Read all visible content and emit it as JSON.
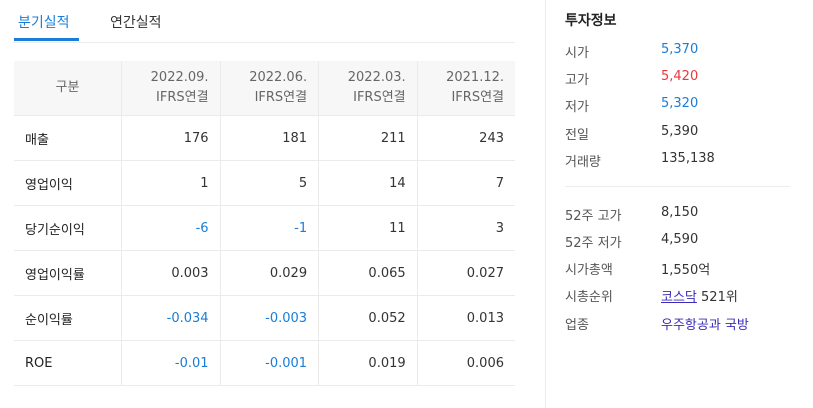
{
  "tabs": [
    {
      "label": "분기실적",
      "active": true
    },
    {
      "label": "연간실적",
      "active": false
    }
  ],
  "financials": {
    "header_label": "구분",
    "columns": [
      {
        "period": "2022.09.",
        "basis": "IFRS연결"
      },
      {
        "period": "2022.06.",
        "basis": "IFRS연결"
      },
      {
        "period": "2022.03.",
        "basis": "IFRS연결"
      },
      {
        "period": "2021.12.",
        "basis": "IFRS연결"
      }
    ],
    "rows": [
      {
        "label": "매출",
        "values": [
          "176",
          "181",
          "211",
          "243"
        ]
      },
      {
        "label": "영업이익",
        "values": [
          "1",
          "5",
          "14",
          "7"
        ]
      },
      {
        "label": "당기순이익",
        "values": [
          "-6",
          "-1",
          "11",
          "3"
        ]
      },
      {
        "label": "영업이익률",
        "values": [
          "0.003",
          "0.029",
          "0.065",
          "0.027"
        ]
      },
      {
        "label": "순이익률",
        "values": [
          "-0.034",
          "-0.003",
          "0.052",
          "0.013"
        ]
      },
      {
        "label": "ROE",
        "values": [
          "-0.01",
          "-0.001",
          "0.019",
          "0.006"
        ]
      }
    ]
  },
  "investment_info": {
    "title": "투자정보",
    "price": [
      {
        "label": "시가",
        "value": "5,370",
        "color": "#1a7dd6"
      },
      {
        "label": "고가",
        "value": "5,420",
        "color": "#e8383d"
      },
      {
        "label": "저가",
        "value": "5,320",
        "color": "#1a7dd6"
      },
      {
        "label": "전일",
        "value": "5,390",
        "color": "#333333"
      },
      {
        "label": "거래량",
        "value": "135,138",
        "color": "#333333"
      }
    ],
    "high52_label": "52주 고가",
    "high52_value": "8,150",
    "low52_label": "52주 저가",
    "low52_value": "4,590",
    "mcap_label": "시가총액",
    "mcap_value": "1,550억",
    "rank_label": "시총순위",
    "rank_market": "코스닥",
    "rank_value": "521위",
    "sector_label": "업종",
    "sector_value": "우주항공과 국방"
  },
  "colors": {
    "accent": "#1a7dd6",
    "up": "#e8383d",
    "link": "#3a2bb8"
  }
}
